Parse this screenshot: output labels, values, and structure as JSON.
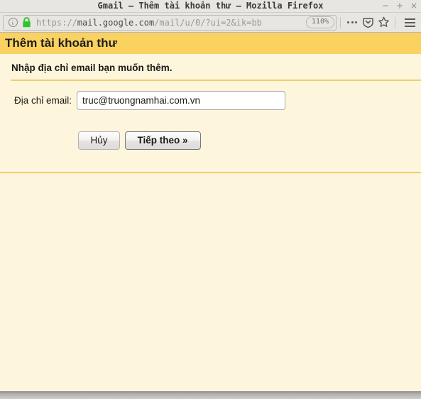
{
  "window": {
    "title": "Gmail – Thêm tài khoản thư – Mozilla Firefox",
    "controls": {
      "minimize": "−",
      "maximize": "+",
      "close": "×"
    }
  },
  "toolbar": {
    "url_prefix": "https://",
    "url_host": "mail.google.com",
    "url_path": "/mail/u/0/?ui=2&ik=bb",
    "zoom_level": "110%",
    "icons": {
      "identity": "info-circle-icon",
      "security": "padlock-icon",
      "page_actions": "ellipsis-icon",
      "pocket": "pocket-shield-icon",
      "bookmark": "star-icon",
      "menu": "hamburger-menu-icon"
    }
  },
  "page": {
    "header_title": "Thêm tài khoản thư",
    "subtitle": "Nhập địa chỉ email bạn muốn thêm.",
    "form": {
      "email_label": "Địa chỉ email:",
      "email_value": "truc@truongnamhai.com.vn",
      "email_placeholder": ""
    },
    "buttons": {
      "cancel": "Hủy",
      "next": "Tiếp theo »"
    }
  },
  "colors": {
    "header_band": "#f9d25f",
    "page_background": "#fdf5dc",
    "divider": "#f0cf6a",
    "chrome": "#e8e6e3",
    "lock_green": "#2fc52f"
  }
}
